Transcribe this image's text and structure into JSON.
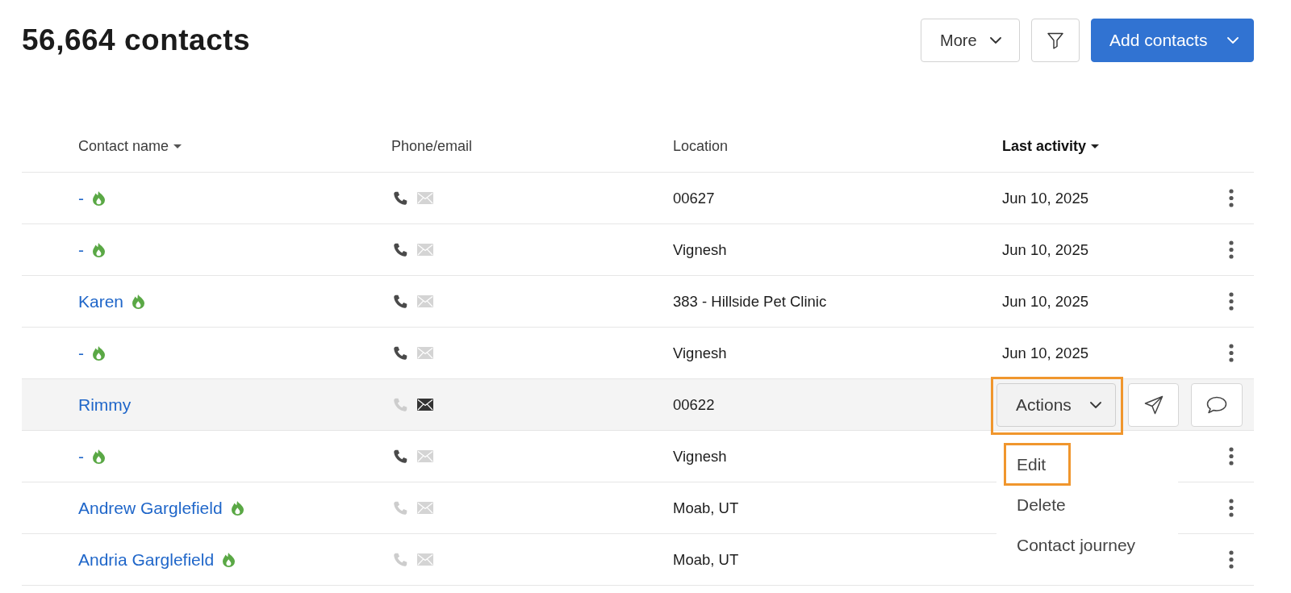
{
  "header": {
    "title": "56,664 contacts",
    "buttons": [
      {
        "kind": "dropdown",
        "label": "More"
      },
      {
        "kind": "filter"
      },
      {
        "kind": "primary",
        "label": "Add contacts"
      }
    ]
  },
  "table": {
    "columns": [
      {
        "label": "Contact name",
        "sortable": true,
        "sorted": false
      },
      {
        "label": "Phone/email",
        "sortable": false,
        "sorted": false
      },
      {
        "label": "Location",
        "sortable": false,
        "sorted": false
      },
      {
        "label": "Last activity",
        "sortable": true,
        "sorted": true
      }
    ],
    "rows": [
      {
        "name": "-",
        "hot": true,
        "phone": true,
        "email": false,
        "location": "00627",
        "last_activity": "Jun 10, 2025",
        "hovered": false
      },
      {
        "name": "-",
        "hot": true,
        "phone": true,
        "email": false,
        "location": "Vignesh",
        "last_activity": "Jun 10, 2025",
        "hovered": false
      },
      {
        "name": "Karen",
        "hot": true,
        "phone": true,
        "email": false,
        "location": "383 - Hillside Pet Clinic",
        "last_activity": "Jun 10, 2025",
        "hovered": false
      },
      {
        "name": "-",
        "hot": true,
        "phone": true,
        "email": false,
        "location": "Vignesh",
        "last_activity": "Jun 10, 2025",
        "hovered": false
      },
      {
        "name": "Rimmy",
        "hot": false,
        "phone": false,
        "email": true,
        "location": "00622",
        "hovered": true,
        "actions": {
          "label": "Actions",
          "highlighted": true,
          "menu": [
            {
              "label": "Edit",
              "highlighted": true
            },
            {
              "label": "Delete",
              "highlighted": false
            },
            {
              "label": "Contact journey",
              "highlighted": false
            }
          ]
        }
      },
      {
        "name": "-",
        "hot": true,
        "phone": true,
        "email": false,
        "location": "Vignesh",
        "hovered": false
      },
      {
        "name": "Andrew Garglefield",
        "hot": true,
        "phone": false,
        "email": false,
        "location": "Moab, UT",
        "hovered": false
      },
      {
        "name": "Andria Garglefield",
        "hot": true,
        "phone": false,
        "email": false,
        "location": "Moab, UT",
        "hovered": false
      }
    ]
  }
}
